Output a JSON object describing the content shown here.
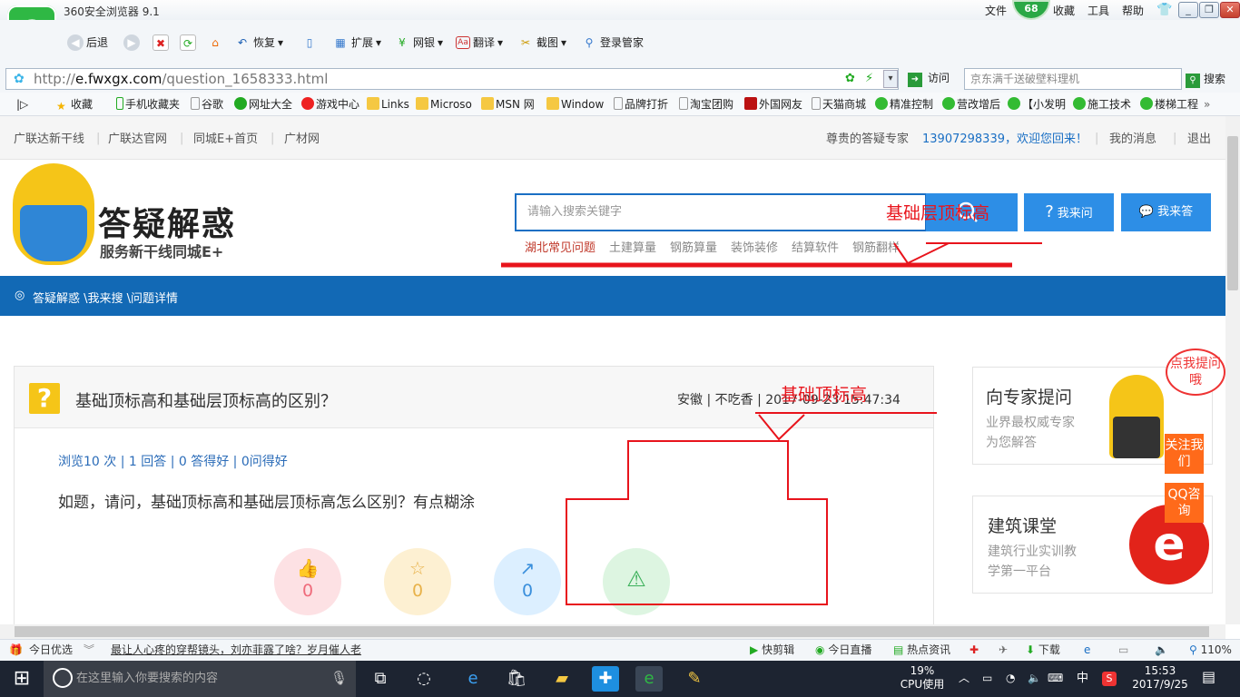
{
  "browser": {
    "title": "360安全浏览器 9.1",
    "menu": [
      "文件",
      "收藏",
      "工具",
      "帮助"
    ],
    "badge_count": "68",
    "toolbar": {
      "back": "后退",
      "restore": "恢复",
      "ext": "扩展",
      "bank": "网银",
      "translate": "翻译",
      "screenshot": "截图",
      "login": "登录管家"
    },
    "url_host": "e.fwxgx.com",
    "url_prefix": "http://",
    "url_path": "/question_1658333.html",
    "visit_label": "访问",
    "search_placeholder": "京东满千送破壁料理机",
    "search_label": "搜索",
    "favorites": [
      "收藏",
      "手机收藏夹",
      "谷歌",
      "网址大全",
      "游戏中心",
      "Links",
      "Microso",
      "MSN 网",
      "Window",
      "品牌打折",
      "淘宝团购",
      "外国网友",
      "天猫商城",
      "精准控制",
      "营改增后",
      "【小发明",
      "施工技术",
      "楼梯工程"
    ]
  },
  "page": {
    "topnav_left": [
      "广联达新干线",
      "广联达官网",
      "同城E+首页",
      "广材网"
    ],
    "welcome_prefix": "尊贵的答疑专家",
    "welcome_user": "13907298339，欢迎您回来！",
    "my_messages": "我的消息",
    "logout": "退出",
    "brand_title": "答疑解惑",
    "brand_sub": "服务新干线同城E+",
    "search_placeholder": "请输入搜索关键字",
    "ask_button": "我来问",
    "answer_button": "我来答",
    "hot_tags": [
      "湖北常见问题",
      "土建算量",
      "钢筋算量",
      "装饰装修",
      "结算软件",
      "钢筋翻样"
    ],
    "breadcrumb": "答疑解惑 \\我来搜 \\问题详情",
    "question": {
      "title": "基础顶标高和基础层顶标高的区别？",
      "meta": "安徽 | 不吃香 | 2017-09-23 15:47:34",
      "stats": "浏览10 次 | 1 回答 | 0 答得好 | 0问得好",
      "body": "如题，请问，基础顶标高和基础层顶标高怎么区别？有点糊涂",
      "counts": [
        "0",
        "0",
        "0"
      ]
    },
    "sidebar": {
      "expert_title": "向专家提问",
      "expert_desc1": "业界最权威专家",
      "expert_desc2": "为您解答",
      "course_title": "建筑课堂",
      "course_desc1": "建筑行业实训教",
      "course_desc2": "学第一平台",
      "bubble": "点我提问哦",
      "follow": "关注我们",
      "qq": "QQ咨询"
    },
    "annotations": [
      "基础层顶标高",
      "基础顶标高"
    ]
  },
  "statusbar": {
    "today": "今日优选",
    "headline": "最让人心疼的穿帮镜头，刘亦菲露了啥？岁月催人老",
    "items": [
      "快剪辑",
      "今日直播",
      "热点资讯",
      "下载"
    ],
    "zoom": "110%"
  },
  "taskbar": {
    "search_placeholder": "在这里输入你要搜索的内容",
    "cpu": "19%",
    "cpu_label": "CPU使用",
    "ime": "中",
    "time": "15:53",
    "date": "2017/9/25"
  },
  "colors": {
    "brand_blue": "#1269b5",
    "button_blue": "#2d8ee6",
    "accent_red": "#e8141c",
    "mascot_yellow": "#f5c518"
  }
}
